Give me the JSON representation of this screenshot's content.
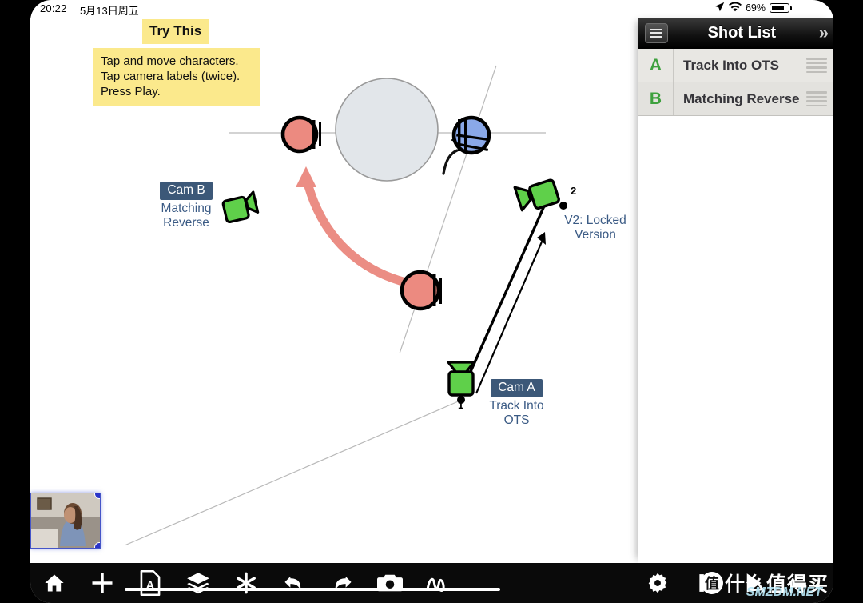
{
  "status_bar": {
    "time": "20:22",
    "date": "5月13日周五",
    "location_icon": "location-arrow-icon",
    "wifi_icon": "wifi-icon",
    "battery_percent": "69%",
    "battery_level": 69
  },
  "notes": {
    "title": "Try This",
    "body": "Tap and move characters.\nTap camera labels (twice).\nPress Play."
  },
  "canvas": {
    "cam_a": {
      "chip": "Cam A",
      "subtitle": "Track Into\nOTS",
      "point_number": "1"
    },
    "cam_b": {
      "chip": "Cam B",
      "subtitle": "Matching\nReverse"
    },
    "version_label": "V2: Locked\nVersion",
    "point_two_number": "2",
    "colors": {
      "character_red": "#ec8a80",
      "character_blue": "#8aa8e8",
      "camera_green": "#5fd04a",
      "table_gray": "#e2e6ea",
      "move_arrow": "#eb8d84",
      "label_chip_bg": "#3c5878",
      "label_text": "#3a5a84",
      "note_yellow": "#fbe98c"
    }
  },
  "shot_list": {
    "header_title": "Shot List",
    "menu_icon": "list-menu-icon",
    "collapse_icon": "double-chevron-right-icon",
    "rows": [
      {
        "letter": "A",
        "title": "Track Into OTS",
        "handle_icon": "drag-handle-icon"
      },
      {
        "letter": "B",
        "title": "Matching Reverse",
        "handle_icon": "drag-handle-icon"
      }
    ]
  },
  "toolbar": {
    "items": [
      {
        "name": "home-icon",
        "label": "Home"
      },
      {
        "name": "plus-icon",
        "label": "Add"
      },
      {
        "name": "text-document-icon",
        "label": "Text"
      },
      {
        "name": "layers-icon",
        "label": "Layers"
      },
      {
        "name": "asterisk-icon",
        "label": "Snap"
      },
      {
        "name": "undo-icon",
        "label": "Undo"
      },
      {
        "name": "redo-icon",
        "label": "Redo"
      },
      {
        "name": "camera-icon",
        "label": "Camera"
      },
      {
        "name": "squiggle-icon",
        "label": "Draw"
      },
      {
        "name": "gear-icon",
        "label": "Settings"
      },
      {
        "name": "pause-icon",
        "label": "Pause"
      },
      {
        "name": "play-icon",
        "label": "Play"
      }
    ],
    "frame_start": "1",
    "frame_end": "2"
  },
  "watermark": {
    "badge": "值",
    "text": "什么值得买",
    "site": "SMZDM.NET"
  }
}
